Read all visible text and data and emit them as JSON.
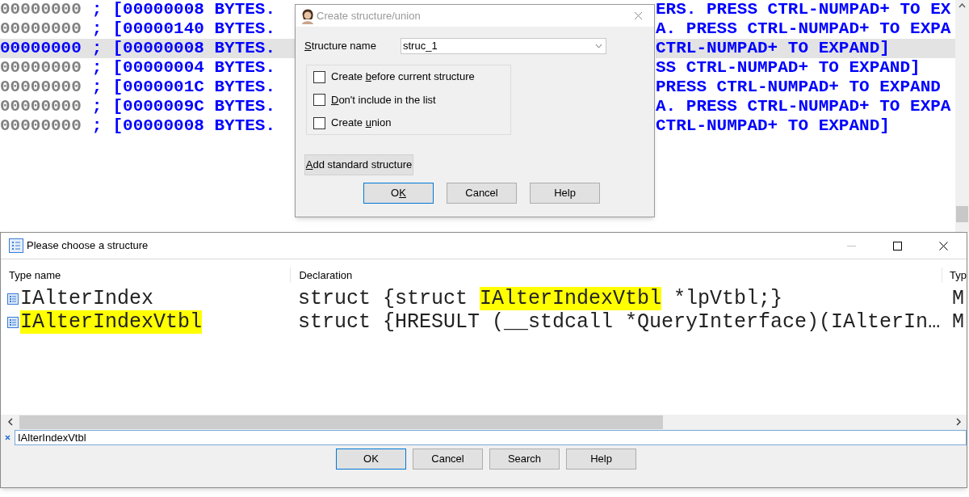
{
  "listing": {
    "rows": [
      {
        "address": "00000000",
        "separator": ";",
        "size": "[00000008 BYTES.",
        "tail": "ERS. PRESS CTRL-NUMPAD+ TO EX",
        "selected": false
      },
      {
        "address": "00000000",
        "separator": ";",
        "size": "[00000140 BYTES.",
        "tail": "A. PRESS CTRL-NUMPAD+ TO EXPA",
        "selected": false
      },
      {
        "address": "00000000",
        "separator": ";",
        "size": "[00000008 BYTES.",
        "tail": "CTRL-NUMPAD+ TO EXPAND]",
        "selected": true
      },
      {
        "address": "00000000",
        "separator": ";",
        "size": "[00000004 BYTES.",
        "tail": "SS CTRL-NUMPAD+ TO EXPAND]",
        "selected": false
      },
      {
        "address": "00000000",
        "separator": ";",
        "size": "[0000001C BYTES.",
        "tail": "PRESS CTRL-NUMPAD+ TO EXPAND",
        "selected": false
      },
      {
        "address": "00000000",
        "separator": ";",
        "size": "[0000009C BYTES.",
        "tail": "A. PRESS CTRL-NUMPAD+ TO EXPA",
        "selected": false
      },
      {
        "address": "00000000",
        "separator": ";",
        "size": "[00000008 BYTES.",
        "tail": "CTRL-NUMPAD+ TO EXPAND]",
        "selected": false
      }
    ]
  },
  "create_dialog": {
    "title": "Create structure/union",
    "name_label": [
      {
        "text": "S",
        "underlined": true
      },
      {
        "text": "tructure name",
        "underlined": false
      }
    ],
    "name_value": "struc_1",
    "options": [
      {
        "label": [
          {
            "text": "Create ",
            "underlined": false
          },
          {
            "text": "b",
            "underlined": true
          },
          {
            "text": "efore current structure",
            "underlined": false
          }
        ],
        "checked": false
      },
      {
        "label": [
          {
            "text": "D",
            "underlined": true
          },
          {
            "text": "on't include in the list",
            "underlined": false
          }
        ],
        "checked": false
      },
      {
        "label": [
          {
            "text": "Create ",
            "underlined": false
          },
          {
            "text": "u",
            "underlined": true
          },
          {
            "text": "nion",
            "underlined": false
          }
        ],
        "checked": false
      }
    ],
    "add_button": {
      "label": [
        {
          "text": "A",
          "underlined": true
        },
        {
          "text": "dd standard structure",
          "underlined": false
        }
      ]
    },
    "buttons": [
      {
        "label": [
          {
            "text": "O",
            "underlined": false
          },
          {
            "text": "K",
            "underlined": true
          }
        ],
        "default": true
      },
      {
        "label": [
          {
            "text": "Cancel",
            "underlined": false
          }
        ],
        "default": false
      },
      {
        "label": [
          {
            "text": "Help",
            "underlined": false
          }
        ],
        "default": false
      }
    ]
  },
  "choose_dialog": {
    "title": "Please choose a structure",
    "columns": [
      "Type name",
      "Declaration",
      "Typ"
    ],
    "rows": [
      {
        "name": "IAlterIndex",
        "name_highlighted": false,
        "declaration": [
          {
            "text": "struct {struct ",
            "highlighted": false
          },
          {
            "text": "IAlterIndexVtbl",
            "highlighted": true
          },
          {
            "text": " *lpVtbl;}",
            "highlighted": false
          }
        ],
        "column_3": "M"
      },
      {
        "name": "IAlterIndexVtbl",
        "name_highlighted": true,
        "declaration": [
          {
            "text": "struct {HRESULT (__stdcall *QueryInterface)(IAlterIn…",
            "highlighted": false
          }
        ],
        "column_3": "M"
      }
    ],
    "search_value": "IAlterIndexVtbl",
    "buttons": [
      {
        "label": [
          {
            "text": "OK",
            "underlined": false
          }
        ],
        "default": true
      },
      {
        "label": [
          {
            "text": "Cancel",
            "underlined": false
          }
        ],
        "default": false
      },
      {
        "label": [
          {
            "text": "Search",
            "underlined": false
          }
        ],
        "default": false
      },
      {
        "label": [
          {
            "text": "Help",
            "underlined": false
          }
        ],
        "default": false
      }
    ]
  }
}
